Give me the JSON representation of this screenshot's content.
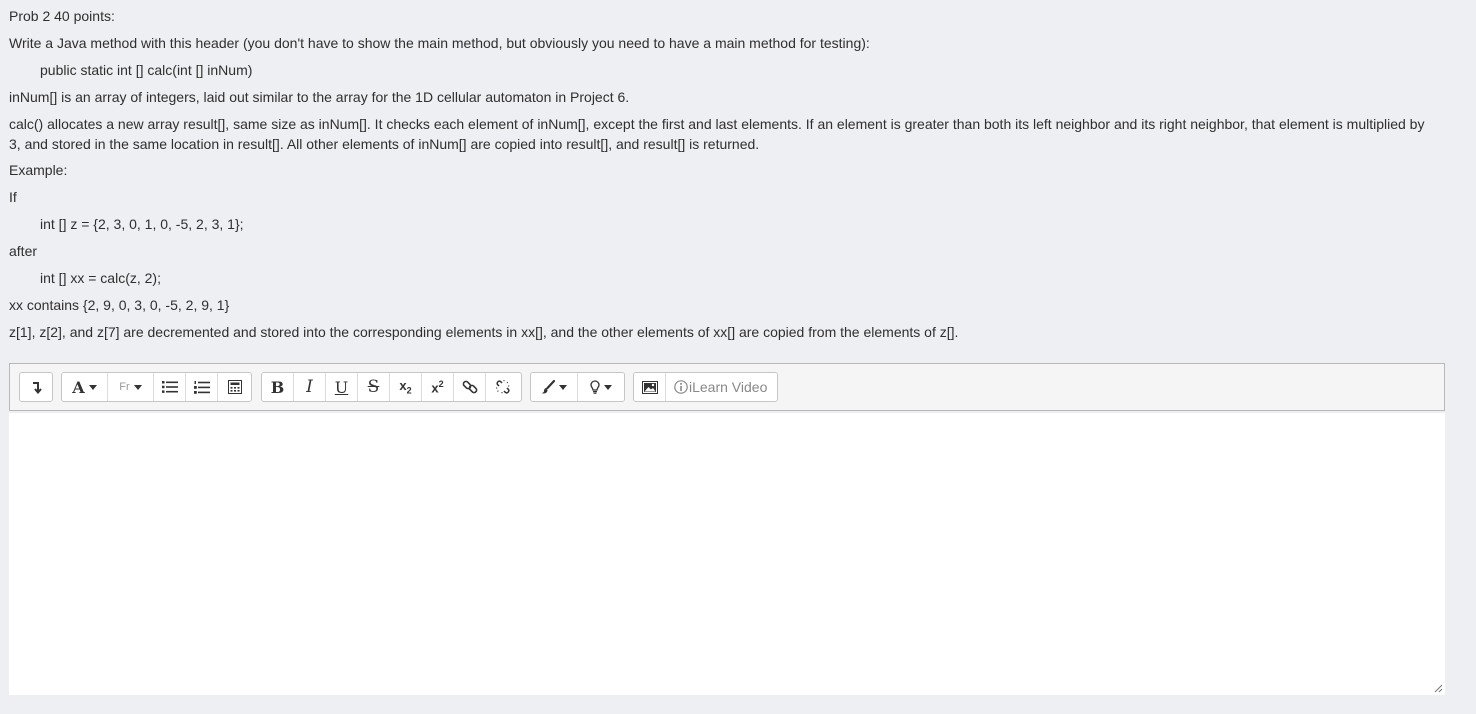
{
  "question": {
    "title": "Prob 2 40 points:",
    "intro": "Write a Java method with this header (you don't have to show the main method, but obviously you need to have a main method for testing):",
    "header_code": "public static int [] calc(int [] inNum)",
    "desc1": "inNum[] is an array of integers, laid out similar to the array for the 1D cellular automaton in Project 6.",
    "desc2": "calc() allocates a new array result[], same size as inNum[]. It checks each element of inNum[], except the first and last elements. If an element is greater than both its left neighbor and its right neighbor, that element is multiplied by 3, and stored in the same location in result[]. All other elements of inNum[] are copied into result[], and result[] is returned.",
    "example_label": "Example:",
    "if_label": "If",
    "code1": "int [] z = {2, 3, 0, 1, 0, -5, 2, 3, 1};",
    "after_label": "after",
    "code2": "int [] xx = calc(z, 2);",
    "result": "xx contains {2, 9, 0, 3, 0, -5, 2, 9, 1}",
    "note": "z[1], z[2], and z[7] are decremented and stored into the corresponding elements in xx[], and the other elements of xx[] are copied from the elements of z[]."
  },
  "toolbar": {
    "collapse_icon": "toolbar-toggle-icon",
    "font_size_glyph": "A",
    "font_family_glyph": "Fr",
    "bold": "B",
    "italic": "I",
    "underline": "U",
    "strike": "S",
    "subscript": "x",
    "subscript_mark": "2",
    "superscript": "x",
    "superscript_mark": "2",
    "video_label": "iLearn Video"
  },
  "editor": {
    "content": ""
  }
}
